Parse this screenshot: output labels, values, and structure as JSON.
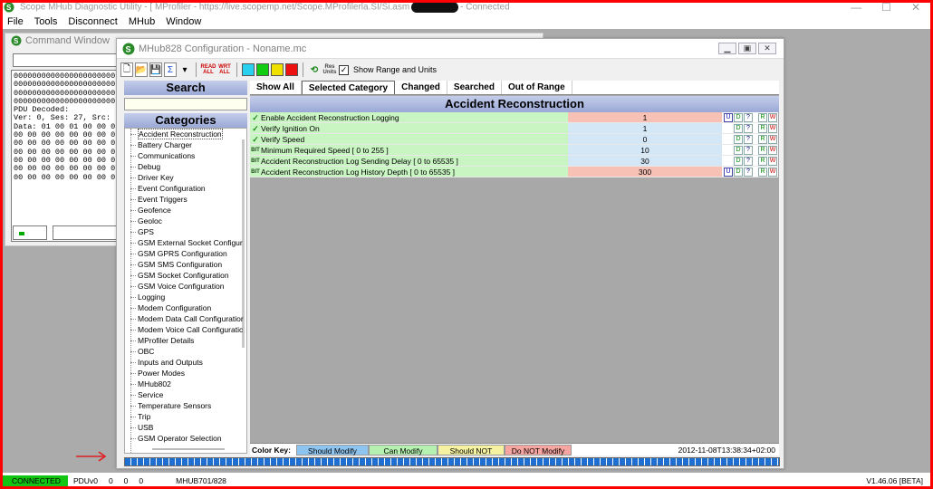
{
  "app": {
    "title_prefix": "Scope MHub Diagnostic Utility - [ MProfiler - https://live.scopemp.net/Scope.MProfilerla.SI/Si.asm",
    "title_suffix": "- Connected",
    "win_min": "—",
    "win_max": "☐",
    "win_close": "✕"
  },
  "menu": [
    "File",
    "Tools",
    "Disconnect",
    "MHub",
    "Window"
  ],
  "command_window": {
    "title": "Command Window",
    "output_lines": [
      "0000000000000000000000",
      "0000000000000000000000",
      "0000000000000000000000",
      "0000000000000000000000",
      "PDU Decoded:",
      "Ver: 0, Ses: 27, Src:",
      "Data: 01 00 01 00 00 0",
      "00 00 00 00 00 00 00 0",
      "00 00 00 00 00 00 00 0",
      "00 00 00 00 00 00 00 0",
      "00 00 00 00 00 00 00 0",
      "00 00 00 00 00 00 00 0",
      "00 00 00 00 00 00 00 0"
    ]
  },
  "config_window": {
    "title": "MHub828 Configuration - Noname.mc",
    "toolbar": {
      "read_all": "READ ALL",
      "write_all": "WRT ALL",
      "res_units": "Res Units",
      "show_range_label": "Show Range and Units",
      "colors": [
        "#2ad0f0",
        "#11cc11",
        "#f0e000",
        "#ee1111"
      ]
    },
    "search_header": "Search",
    "categories_header": "Categories",
    "categories": [
      "Accident Reconstruction",
      "Battery Charger",
      "Communications",
      "Debug",
      "Driver Key",
      "Event Configuration",
      "Event Triggers",
      "Geofence",
      "Geoloc",
      "GPS",
      "GSM External Socket Configur",
      "GSM GPRS Configuration",
      "GSM SMS Configuration",
      "GSM Socket Configuration",
      "GSM Voice Configuration",
      "Logging",
      "Modem Configuration",
      "Modem Data Call Configuratior",
      "Modem Voice Call Configuratic",
      "MProfiler Details",
      "OBC",
      "Inputs and Outputs",
      "Power Modes",
      "MHub802",
      "Service",
      "Temperature Sensors",
      "Trip",
      "USB",
      "GSM Operator Selection"
    ],
    "tabs": [
      "Show All",
      "Selected Category",
      "Changed",
      "Searched",
      "Out of Range"
    ],
    "section_title": "Accident Reconstruction",
    "rows": [
      {
        "marker": "✓",
        "name": "Enable Accident Reconstruction Logging",
        "value": "1",
        "tone": "pink",
        "u": "U"
      },
      {
        "marker": "✓",
        "name": "Verify Ignition On",
        "value": "1",
        "tone": "blue",
        "u": ""
      },
      {
        "marker": "✓",
        "name": "Verify Speed",
        "value": "0",
        "tone": "blue",
        "u": ""
      },
      {
        "marker": "BIT",
        "name": "Minimum Required Speed  [ 0 to 255 ]",
        "value": "10",
        "tone": "blue",
        "u": ""
      },
      {
        "marker": "BIT",
        "name": "Accident Reconstruction Log Sending Delay  [ 0 to 65535 ]",
        "value": "30",
        "tone": "blue",
        "u": ""
      },
      {
        "marker": "BIT",
        "name": "Accident Reconstruction Log History Depth  [ 0 to 65535 ]",
        "value": "300",
        "tone": "pink",
        "u": "U"
      }
    ],
    "flag_labels": {
      "d": "D",
      "q": "?",
      "r": "R",
      "w": "W"
    },
    "color_key": {
      "label": "Color Key:",
      "should": "Should Modify",
      "can": "Can Modify",
      "should_not": "Should NOT Modify",
      "do_not": "Do NOT Modify"
    },
    "timestamp": "2012-11-08T13:38:34+02:00"
  },
  "status_bar": {
    "connected": "CONNECTED",
    "pdu": "PDUv0",
    "n1": "0",
    "n2": "0",
    "n3": "0",
    "device": "MHUB701/828",
    "version": "V1.46.06 [BETA]"
  }
}
